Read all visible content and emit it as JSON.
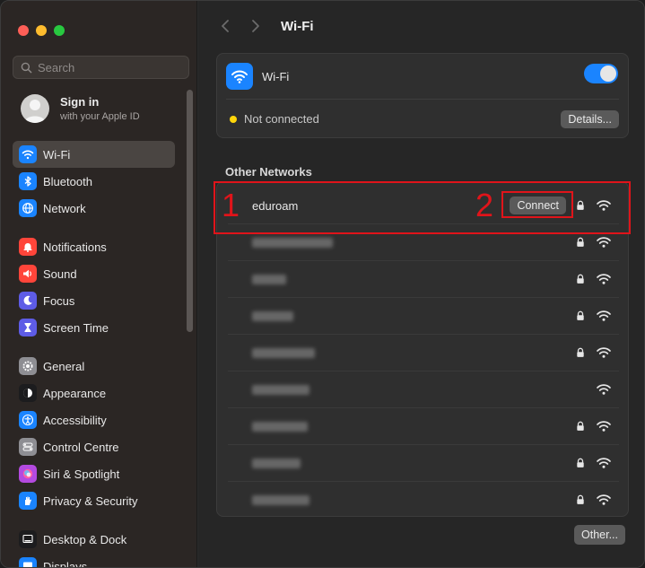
{
  "sidebar": {
    "search_placeholder": "Search",
    "signin": {
      "title": "Sign in",
      "subtitle": "with your Apple ID"
    },
    "groups": [
      [
        {
          "label": "Wi-Fi",
          "icon": "wifi-icon",
          "color": "#1a84ff",
          "active": true
        },
        {
          "label": "Bluetooth",
          "icon": "bluetooth-icon",
          "color": "#1a84ff"
        },
        {
          "label": "Network",
          "icon": "globe-icon",
          "color": "#1a84ff"
        }
      ],
      [
        {
          "label": "Notifications",
          "icon": "bell-icon",
          "color": "#ff453a"
        },
        {
          "label": "Sound",
          "icon": "speaker-icon",
          "color": "#ff453a"
        },
        {
          "label": "Focus",
          "icon": "moon-icon",
          "color": "#5e5ce6"
        },
        {
          "label": "Screen Time",
          "icon": "hourglass-icon",
          "color": "#5e5ce6"
        }
      ],
      [
        {
          "label": "General",
          "icon": "gear-icon",
          "color": "#8e8e93"
        },
        {
          "label": "Appearance",
          "icon": "appearance-icon",
          "color": "#1c1c1e"
        },
        {
          "label": "Accessibility",
          "icon": "accessibility-icon",
          "color": "#1a84ff"
        },
        {
          "label": "Control Centre",
          "icon": "control-centre-icon",
          "color": "#8e8e93"
        },
        {
          "label": "Siri & Spotlight",
          "icon": "siri-icon",
          "color": "#b44ae0"
        },
        {
          "label": "Privacy & Security",
          "icon": "hand-icon",
          "color": "#1a84ff"
        }
      ],
      [
        {
          "label": "Desktop & Dock",
          "icon": "dock-icon",
          "color": "#1c1c1e"
        },
        {
          "label": "Displays",
          "icon": "display-icon",
          "color": "#1a84ff"
        }
      ]
    ]
  },
  "toolbar": {
    "title": "Wi-Fi"
  },
  "wifi_card": {
    "label": "Wi-Fi",
    "enabled": true,
    "status": "Not connected",
    "details_label": "Details..."
  },
  "other_networks": {
    "title": "Other Networks",
    "connect_label": "Connect",
    "networks": [
      {
        "name": "eduroam",
        "locked": true,
        "blurred": false
      },
      {
        "name": "",
        "locked": true,
        "blurred": true
      },
      {
        "name": "",
        "locked": true,
        "blurred": true
      },
      {
        "name": "",
        "locked": true,
        "blurred": true
      },
      {
        "name": "",
        "locked": true,
        "blurred": true
      },
      {
        "name": "",
        "locked": false,
        "blurred": true
      },
      {
        "name": "",
        "locked": true,
        "blurred": true
      },
      {
        "name": "",
        "locked": true,
        "blurred": true
      },
      {
        "name": "",
        "locked": true,
        "blurred": true
      }
    ],
    "other_label": "Other..."
  },
  "annotations": {
    "label_1": "1",
    "label_2": "2"
  },
  "colors": {
    "accent": "#1a84ff",
    "annotation": "#e0141a",
    "status_dot": "#ffd60a"
  }
}
